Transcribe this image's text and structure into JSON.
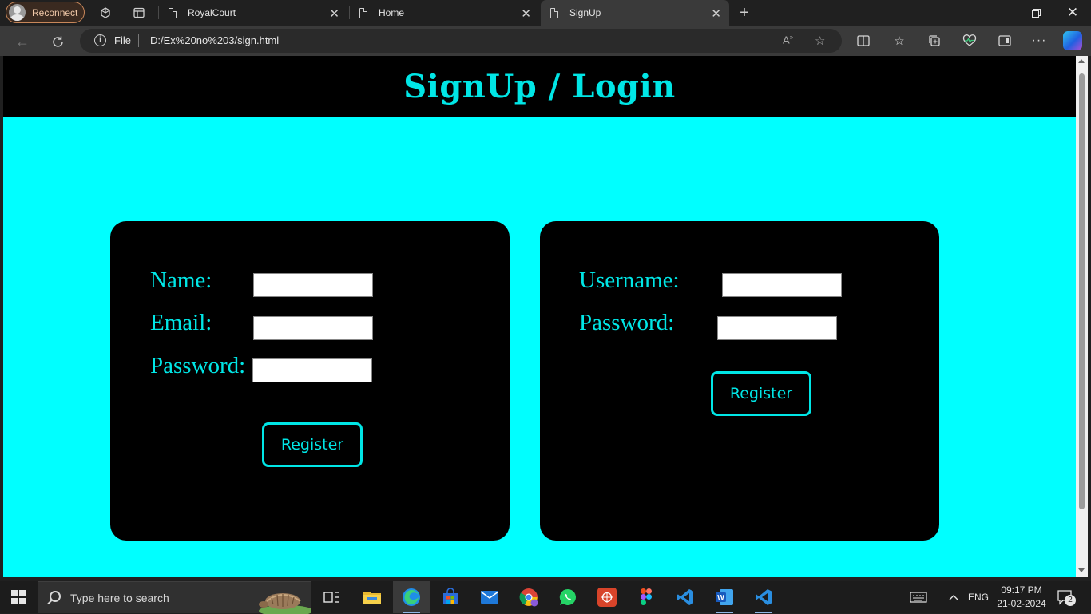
{
  "browser": {
    "profile_label": "Reconnect",
    "tabs": [
      {
        "title": "RoyalCourt",
        "active": false
      },
      {
        "title": "Home",
        "active": false
      },
      {
        "title": "SignUp",
        "active": true
      }
    ],
    "address": {
      "scheme_label": "File",
      "url": "D:/Ex%20no%203/sign.html"
    }
  },
  "page": {
    "title": "SignUp / Login",
    "colors": {
      "background": "#00ffff",
      "header": "#000000",
      "accent": "#00e6e6"
    },
    "signup_form": {
      "fields": [
        {
          "label": "Name:",
          "value": ""
        },
        {
          "label": "Email:",
          "value": ""
        },
        {
          "label": "Password:",
          "value": ""
        }
      ],
      "button_label": "Register"
    },
    "login_form": {
      "fields": [
        {
          "label": "Username:",
          "value": ""
        },
        {
          "label": "Password:",
          "value": ""
        }
      ],
      "button_label": "Register"
    }
  },
  "taskbar": {
    "search_placeholder": "Type here to search",
    "apps": [
      "task-view",
      "file-explorer",
      "edge",
      "microsoft-store",
      "mail",
      "chrome",
      "whatsapp",
      "app-red",
      "figma",
      "vscode",
      "word",
      "vscode"
    ],
    "language": "ENG",
    "time": "09:17 PM",
    "date": "21-02-2024",
    "notification_count": "2"
  }
}
